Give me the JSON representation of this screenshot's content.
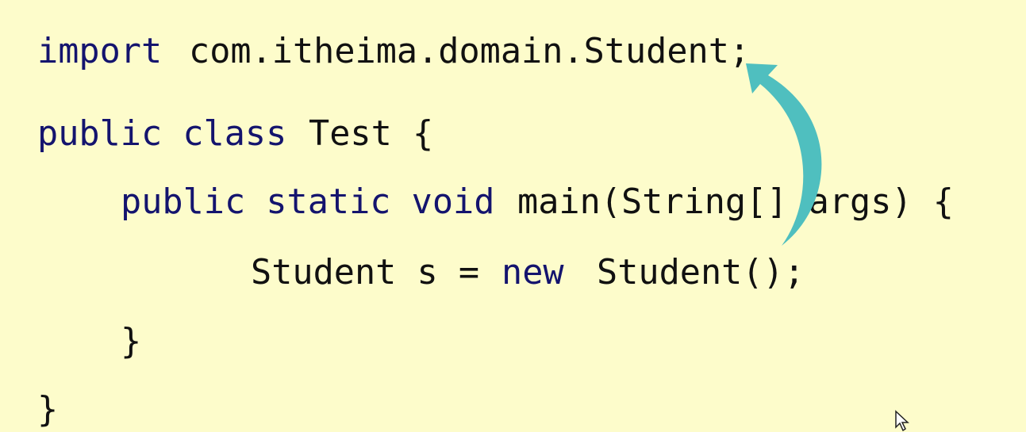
{
  "code": {
    "line1": {
      "keyword": "import",
      "text": "com.itheima.domain.Student;"
    },
    "line2": {
      "keyword": "public class",
      "text": "Test {"
    },
    "line3": {
      "keyword": "public static void",
      "text": "main(String[] args) {"
    },
    "line4": {
      "text1": "Student s =",
      "keyword": "new",
      "text2": "Student();"
    },
    "line5": {
      "text": "}"
    },
    "line6": {
      "text": "}"
    }
  },
  "colors": {
    "background": "#fdfccb",
    "keyword": "#14146e",
    "arrow": "#4fbfbf"
  },
  "icons": {
    "annotation": "curved-arrow-icon",
    "pointer": "mouse-cursor-icon"
  }
}
